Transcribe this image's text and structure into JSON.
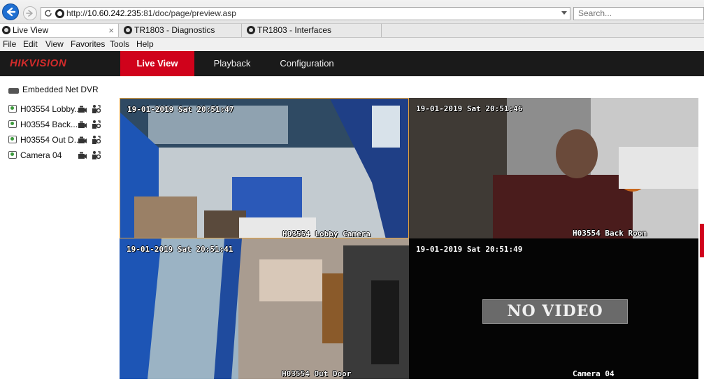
{
  "browser": {
    "url_prefix": "http://",
    "url_host": "10.60.242.235",
    "url_rest": ":81/doc/page/preview.asp",
    "search_placeholder": "Search...",
    "tabs": [
      {
        "label": "Live View",
        "close": "×"
      },
      {
        "label": "TR1803 - Diagnostics"
      },
      {
        "label": "TR1803 - Interfaces"
      }
    ],
    "menu": [
      "File",
      "Edit",
      "View",
      "Favorites",
      "Tools",
      "Help"
    ]
  },
  "app": {
    "logo": "HIKVISION",
    "nav": [
      "Live View",
      "Playback",
      "Configuration"
    ],
    "device": "Embedded Net DVR",
    "cameras": [
      "H03554 Lobby...",
      "H03554 Back...",
      "H03554 Out D...",
      "Camera 04"
    ]
  },
  "feeds": [
    {
      "timestamp": "19-01-2019 Sat 20:51:47",
      "name": "H03554 Lobby Camera"
    },
    {
      "timestamp": "19-01-2019 Sat 20:51:46",
      "name": "H03554 Back Room"
    },
    {
      "timestamp": "19-01-2019 Sat 20:51:41",
      "name": "H03554 Out Door"
    },
    {
      "timestamp": "19-01-2019 Sat 20:51:49",
      "name": "Camera 04",
      "status": "NO VIDEO"
    }
  ],
  "icons": {
    "back": "back-arrow-icon",
    "forward": "forward-arrow-icon",
    "refresh": "refresh-icon",
    "camera": "camera-icon",
    "record": "record-icon",
    "ptz": "ptz-icon"
  },
  "colors": {
    "brand_red": "#d0021b",
    "header_bg": "#1a1a1a",
    "selected_border": "#e8a33a"
  }
}
